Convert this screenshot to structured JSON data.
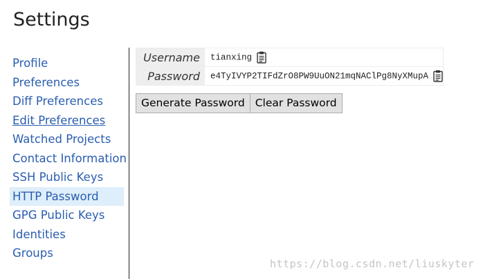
{
  "page": {
    "title": "Settings"
  },
  "sidebar": {
    "items": [
      {
        "label": "Profile"
      },
      {
        "label": "Preferences"
      },
      {
        "label": "Diff Preferences"
      },
      {
        "label": "Edit Preferences"
      },
      {
        "label": "Watched Projects"
      },
      {
        "label": "Contact Information"
      },
      {
        "label": "SSH Public Keys"
      },
      {
        "label": "HTTP Password"
      },
      {
        "label": "GPG Public Keys"
      },
      {
        "label": "Identities"
      },
      {
        "label": "Groups"
      }
    ],
    "active_item": "HTTP Password",
    "hovered_item": "Edit Preferences"
  },
  "credentials": {
    "username_label": "Username",
    "username_value": "tianxing",
    "password_label": "Password",
    "password_value": "e4TyIVYP2TIFdZrO8PW9UuON21mqNAClPg8NyXMupA"
  },
  "actions": {
    "generate_label": "Generate Password",
    "clear_label": "Clear Password"
  },
  "watermark": {
    "text": "https://blog.csdn.net/liuskyter"
  },
  "icons": {
    "copy": "clipboard-icon"
  },
  "colors": {
    "link": "#2a5db0",
    "active_bg": "#deeefa",
    "label_bg": "#eeeeee",
    "button_bg": "#e1e1e1"
  }
}
